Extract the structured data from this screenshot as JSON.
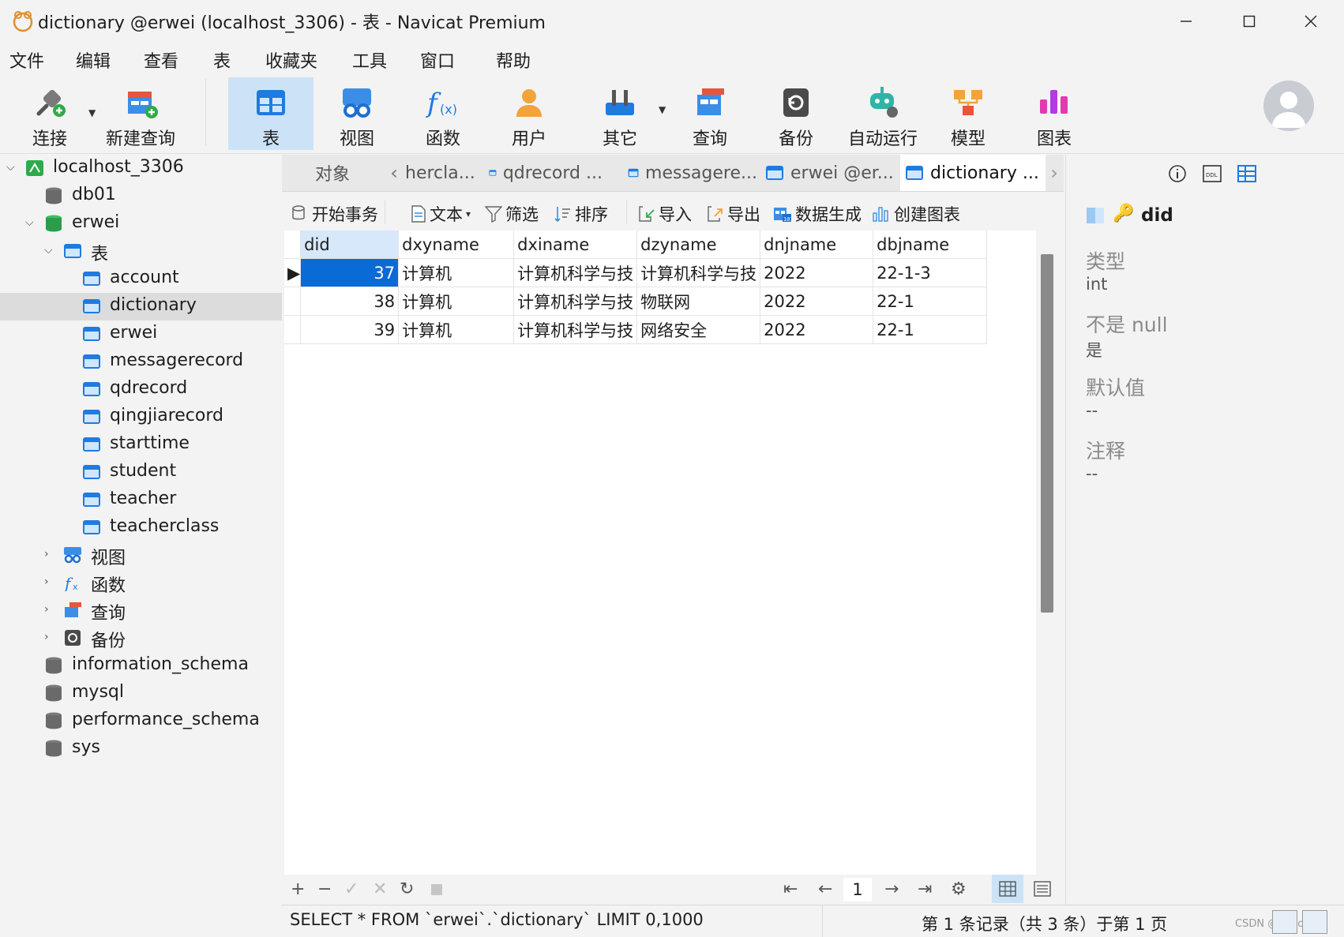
{
  "window": {
    "title": "dictionary @erwei (localhost_3306) - 表 - Navicat Premium"
  },
  "menu": [
    "文件",
    "编辑",
    "查看",
    "表",
    "收藏夹",
    "工具",
    "窗口",
    "帮助"
  ],
  "toolbar": {
    "items": [
      {
        "label": "连接",
        "icon": "plug-icon"
      },
      {
        "label": "新建查询",
        "icon": "new-query-icon"
      },
      {
        "label": "表",
        "icon": "table-icon",
        "active": true
      },
      {
        "label": "视图",
        "icon": "view-icon"
      },
      {
        "label": "函数",
        "icon": "function-icon"
      },
      {
        "label": "用户",
        "icon": "user-icon"
      },
      {
        "label": "其它",
        "icon": "tools-icon"
      },
      {
        "label": "查询",
        "icon": "query-icon"
      },
      {
        "label": "备份",
        "icon": "backup-icon"
      },
      {
        "label": "自动运行",
        "icon": "robot-icon"
      },
      {
        "label": "模型",
        "icon": "model-icon"
      },
      {
        "label": "图表",
        "icon": "chart-icon"
      }
    ]
  },
  "tree": {
    "connection": "localhost_3306",
    "db01": "db01",
    "erwei": "erwei",
    "tables_group": "表",
    "tables": [
      "account",
      "dictionary",
      "erwei",
      "messagerecord",
      "qdrecord",
      "qingjiarecord",
      "starttime",
      "student",
      "teacher",
      "teacherclass"
    ],
    "selected_table": "dictionary",
    "groups": [
      "视图",
      "函数",
      "查询",
      "备份"
    ],
    "other_dbs": [
      "information_schema",
      "mysql",
      "performance_schema",
      "sys"
    ]
  },
  "tabs": {
    "object": "对象",
    "items": [
      "hercla...",
      "qdrecord ...",
      "messagere...",
      "erwei @er...",
      "dictionary ..."
    ],
    "active_index": 4
  },
  "data_toolbar": {
    "begin_tx": "开始事务",
    "text": "文本",
    "filter": "筛选",
    "sort": "排序",
    "import": "导入",
    "export": "导出",
    "data_gen": "数据生成",
    "create_chart": "创建图表"
  },
  "grid": {
    "columns": [
      "did",
      "dxyname",
      "dxiname",
      "dzyname",
      "dnjname",
      "dbjname"
    ],
    "rows": [
      [
        "37",
        "计算机",
        "计算机科学与技",
        "计算机科学与技",
        "2022",
        "22-1-3"
      ],
      [
        "38",
        "计算机",
        "计算机科学与技",
        "物联网",
        "2022",
        "22-1"
      ],
      [
        "39",
        "计算机",
        "计算机科学与技",
        "网络安全",
        "2022",
        "22-1"
      ]
    ]
  },
  "pagination": {
    "page": "1"
  },
  "status": {
    "sql": "SELECT * FROM `erwei`.`dictionary` LIMIT 0,1000",
    "record": "第 1 条记录（共 3 条）于第 1 页",
    "watermark": "CSDN @ZhaoLYH_"
  },
  "field_info": {
    "name": "did",
    "type_label": "类型",
    "type_value": "int",
    "notnull_label": "不是 null",
    "notnull_value": "是",
    "default_label": "默认值",
    "default_value": "--",
    "comment_label": "注释",
    "comment_value": "--"
  },
  "colors": {
    "accent": "#0a6ad6",
    "active_tool": "#cce3f7",
    "table_icon": "#1e7be0",
    "db_green": "#2a9d4b"
  }
}
